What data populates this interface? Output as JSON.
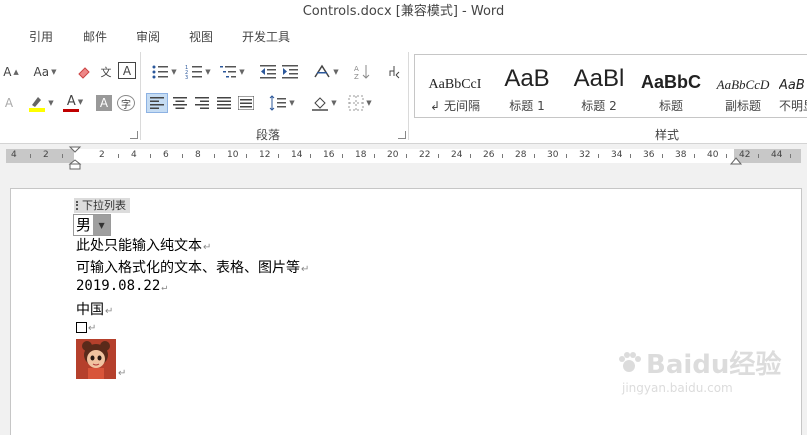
{
  "window": {
    "title": "Controls.docx [兼容模式] - Word"
  },
  "ribbon_tabs": [
    "引用",
    "邮件",
    "审阅",
    "视图",
    "开发工具"
  ],
  "ribbon": {
    "font_group": {
      "size_up_label": "A",
      "change_case_label": "Aa",
      "phonetic_guide_label": "文",
      "char_border_label": "A",
      "font_color_label": "A",
      "char_shading_label": "A",
      "enclose_char_label": "字"
    },
    "paragraph_group": {
      "label": "段落"
    },
    "styles_group": {
      "label": "样式",
      "items": [
        {
          "sample": "AaBbCcI",
          "name": "无间隔",
          "prefix": "↲"
        },
        {
          "sample": "AaB",
          "name": "标题 1"
        },
        {
          "sample": "AaBl",
          "name": "标题 2"
        },
        {
          "sample": "AaBbC",
          "name": "标题"
        },
        {
          "sample": "AaBbCcD",
          "name": "副标题"
        },
        {
          "sample": "AaB",
          "name": "不明显"
        }
      ]
    }
  },
  "ruler": {
    "labels": [
      "4",
      "2",
      "2",
      "4",
      "6",
      "8",
      "10",
      "12",
      "14",
      "16",
      "18",
      "20",
      "22",
      "24",
      "26",
      "28",
      "30",
      "32",
      "34",
      "36",
      "38",
      "40",
      "42",
      "44"
    ]
  },
  "document": {
    "content_control_tag": "下拉列表",
    "dropdown_value": "男",
    "lines": [
      "此处只能输入纯文本",
      "可输入格式化的文本、表格、图片等",
      "2019.08.22",
      "中国"
    ],
    "paragraph_mark": "↵"
  },
  "watermark": {
    "brand": "Baidu经验",
    "url": "jingyan.baidu.com"
  },
  "colors": {
    "accent_blue": "#2b579a",
    "highlight_yellow": "#ffff00",
    "font_red": "#c00000",
    "selected_button": "#c5dcf3"
  }
}
